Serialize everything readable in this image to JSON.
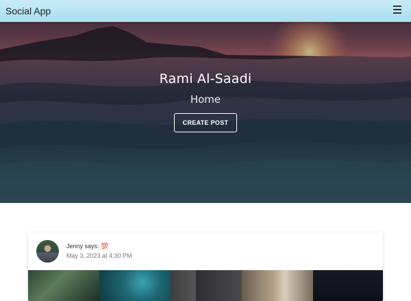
{
  "navbar": {
    "brand": "Social App",
    "menu_icon": "hamburger-menu-icon"
  },
  "hero": {
    "name": "Rami Al-Saadi",
    "subtitle": "Home",
    "create_post_label": "CREATE POST"
  },
  "post": {
    "author_line": "Jenny says:",
    "author_emoji": "💯",
    "date": "May 3, 2023 at 4:30 PM",
    "gallery": [
      "plant-leaves-image",
      "teal-sparkle-image",
      "dark-room-image",
      "blurred-interior-image",
      "night-image"
    ]
  },
  "colors": {
    "navbar": "#a9def0",
    "card_bg": "#ffffff",
    "button_border": "#ffffff"
  }
}
